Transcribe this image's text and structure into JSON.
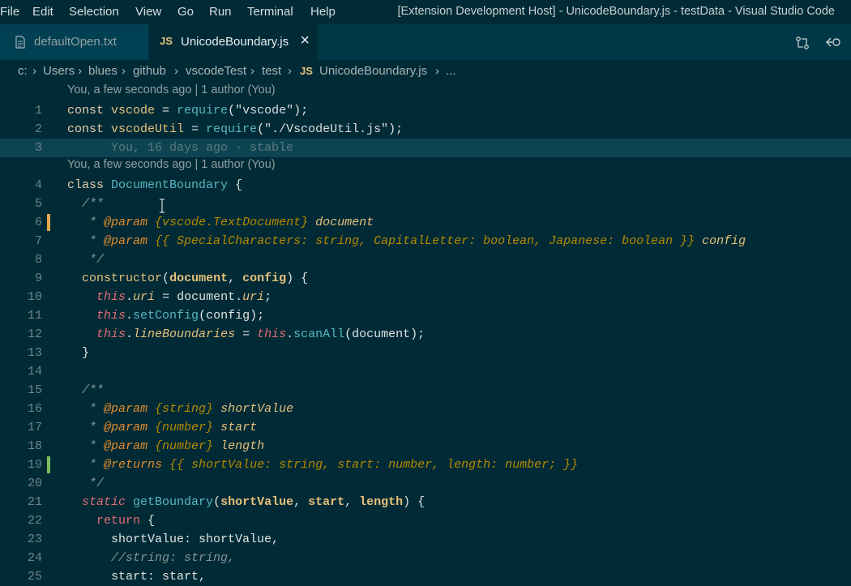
{
  "menu": [
    "File",
    "Edit",
    "Selection",
    "View",
    "Go",
    "Run",
    "Terminal",
    "Help"
  ],
  "window_title": "[Extension Development Host] - UnicodeBoundary.js - testData - Visual Studio Code",
  "tabs": [
    {
      "label": "defaultOpen.txt",
      "icon": "file-icon"
    },
    {
      "label": "UnicodeBoundary.js",
      "icon": "JS",
      "close": "×"
    }
  ],
  "breadcrumb": [
    "c:",
    "Users",
    "blues",
    "github",
    "vscodeTest",
    "test",
    "UnicodeBoundary.js",
    "..."
  ],
  "breadcrumb_js_icon": "JS",
  "codelens": "You, a few seconds ago | 1 author (You)",
  "blame": "You, 16 days ago · stable",
  "lines": [
    {
      "n": "1",
      "t": "const vscode = require(\"vscode\");"
    },
    {
      "n": "2",
      "t": "const vscodeUtil = require(\"./VscodeUtil.js\");"
    },
    {
      "n": "3",
      "t": ""
    },
    {
      "n": "4",
      "t": "class DocumentBoundary {"
    },
    {
      "n": "5",
      "t": "  /**"
    },
    {
      "n": "6",
      "t": "   * @param {vscode.TextDocument} document"
    },
    {
      "n": "7",
      "t": "   * @param {{ SpecialCharacters: string, CapitalLetter: boolean, Japanese: boolean }} config"
    },
    {
      "n": "8",
      "t": "   */"
    },
    {
      "n": "9",
      "t": "  constructor(document, config) {"
    },
    {
      "n": "10",
      "t": "    this.uri = document.uri;"
    },
    {
      "n": "11",
      "t": "    this.setConfig(config);"
    },
    {
      "n": "12",
      "t": "    this.lineBoundaries = this.scanAll(document);"
    },
    {
      "n": "13",
      "t": "  }"
    },
    {
      "n": "14",
      "t": ""
    },
    {
      "n": "15",
      "t": "  /**"
    },
    {
      "n": "16",
      "t": "   * @param {string} shortValue"
    },
    {
      "n": "17",
      "t": "   * @param {number} start"
    },
    {
      "n": "18",
      "t": "   * @param {number} length"
    },
    {
      "n": "19",
      "t": "   * @returns {{ shortValue: string, start: number, length: number; }}"
    },
    {
      "n": "20",
      "t": "   */"
    },
    {
      "n": "21",
      "t": "  static getBoundary(shortValue, start, length) {"
    },
    {
      "n": "22",
      "t": "    return {"
    },
    {
      "n": "23",
      "t": "      shortValue: shortValue,"
    },
    {
      "n": "24",
      "t": "      //string: string,"
    },
    {
      "n": "25",
      "t": "      start: start,"
    }
  ],
  "colors": {
    "bg": "#002b36",
    "tabbar": "#003847",
    "modified": "#e5a84b",
    "added": "#7fbf5a",
    "highlight": "#0e4452"
  }
}
